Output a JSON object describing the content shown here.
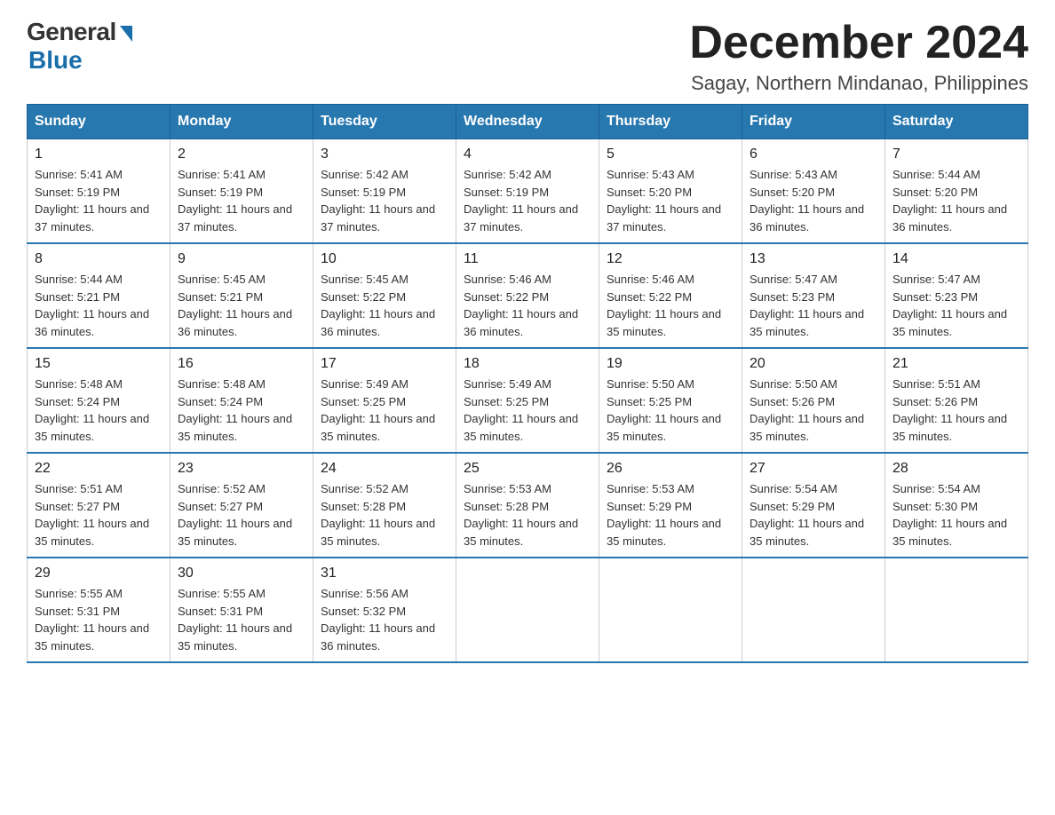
{
  "logo": {
    "general": "General",
    "blue": "Blue"
  },
  "header": {
    "month_year": "December 2024",
    "location": "Sagay, Northern Mindanao, Philippines"
  },
  "weekdays": [
    "Sunday",
    "Monday",
    "Tuesday",
    "Wednesday",
    "Thursday",
    "Friday",
    "Saturday"
  ],
  "weeks": [
    [
      {
        "day": "1",
        "sunrise": "5:41 AM",
        "sunset": "5:19 PM",
        "daylight": "11 hours and 37 minutes."
      },
      {
        "day": "2",
        "sunrise": "5:41 AM",
        "sunset": "5:19 PM",
        "daylight": "11 hours and 37 minutes."
      },
      {
        "day": "3",
        "sunrise": "5:42 AM",
        "sunset": "5:19 PM",
        "daylight": "11 hours and 37 minutes."
      },
      {
        "day": "4",
        "sunrise": "5:42 AM",
        "sunset": "5:19 PM",
        "daylight": "11 hours and 37 minutes."
      },
      {
        "day": "5",
        "sunrise": "5:43 AM",
        "sunset": "5:20 PM",
        "daylight": "11 hours and 37 minutes."
      },
      {
        "day": "6",
        "sunrise": "5:43 AM",
        "sunset": "5:20 PM",
        "daylight": "11 hours and 36 minutes."
      },
      {
        "day": "7",
        "sunrise": "5:44 AM",
        "sunset": "5:20 PM",
        "daylight": "11 hours and 36 minutes."
      }
    ],
    [
      {
        "day": "8",
        "sunrise": "5:44 AM",
        "sunset": "5:21 PM",
        "daylight": "11 hours and 36 minutes."
      },
      {
        "day": "9",
        "sunrise": "5:45 AM",
        "sunset": "5:21 PM",
        "daylight": "11 hours and 36 minutes."
      },
      {
        "day": "10",
        "sunrise": "5:45 AM",
        "sunset": "5:22 PM",
        "daylight": "11 hours and 36 minutes."
      },
      {
        "day": "11",
        "sunrise": "5:46 AM",
        "sunset": "5:22 PM",
        "daylight": "11 hours and 36 minutes."
      },
      {
        "day": "12",
        "sunrise": "5:46 AM",
        "sunset": "5:22 PM",
        "daylight": "11 hours and 35 minutes."
      },
      {
        "day": "13",
        "sunrise": "5:47 AM",
        "sunset": "5:23 PM",
        "daylight": "11 hours and 35 minutes."
      },
      {
        "day": "14",
        "sunrise": "5:47 AM",
        "sunset": "5:23 PM",
        "daylight": "11 hours and 35 minutes."
      }
    ],
    [
      {
        "day": "15",
        "sunrise": "5:48 AM",
        "sunset": "5:24 PM",
        "daylight": "11 hours and 35 minutes."
      },
      {
        "day": "16",
        "sunrise": "5:48 AM",
        "sunset": "5:24 PM",
        "daylight": "11 hours and 35 minutes."
      },
      {
        "day": "17",
        "sunrise": "5:49 AM",
        "sunset": "5:25 PM",
        "daylight": "11 hours and 35 minutes."
      },
      {
        "day": "18",
        "sunrise": "5:49 AM",
        "sunset": "5:25 PM",
        "daylight": "11 hours and 35 minutes."
      },
      {
        "day": "19",
        "sunrise": "5:50 AM",
        "sunset": "5:25 PM",
        "daylight": "11 hours and 35 minutes."
      },
      {
        "day": "20",
        "sunrise": "5:50 AM",
        "sunset": "5:26 PM",
        "daylight": "11 hours and 35 minutes."
      },
      {
        "day": "21",
        "sunrise": "5:51 AM",
        "sunset": "5:26 PM",
        "daylight": "11 hours and 35 minutes."
      }
    ],
    [
      {
        "day": "22",
        "sunrise": "5:51 AM",
        "sunset": "5:27 PM",
        "daylight": "11 hours and 35 minutes."
      },
      {
        "day": "23",
        "sunrise": "5:52 AM",
        "sunset": "5:27 PM",
        "daylight": "11 hours and 35 minutes."
      },
      {
        "day": "24",
        "sunrise": "5:52 AM",
        "sunset": "5:28 PM",
        "daylight": "11 hours and 35 minutes."
      },
      {
        "day": "25",
        "sunrise": "5:53 AM",
        "sunset": "5:28 PM",
        "daylight": "11 hours and 35 minutes."
      },
      {
        "day": "26",
        "sunrise": "5:53 AM",
        "sunset": "5:29 PM",
        "daylight": "11 hours and 35 minutes."
      },
      {
        "day": "27",
        "sunrise": "5:54 AM",
        "sunset": "5:29 PM",
        "daylight": "11 hours and 35 minutes."
      },
      {
        "day": "28",
        "sunrise": "5:54 AM",
        "sunset": "5:30 PM",
        "daylight": "11 hours and 35 minutes."
      }
    ],
    [
      {
        "day": "29",
        "sunrise": "5:55 AM",
        "sunset": "5:31 PM",
        "daylight": "11 hours and 35 minutes."
      },
      {
        "day": "30",
        "sunrise": "5:55 AM",
        "sunset": "5:31 PM",
        "daylight": "11 hours and 35 minutes."
      },
      {
        "day": "31",
        "sunrise": "5:56 AM",
        "sunset": "5:32 PM",
        "daylight": "11 hours and 36 minutes."
      },
      null,
      null,
      null,
      null
    ]
  ],
  "labels": {
    "sunrise": "Sunrise:",
    "sunset": "Sunset:",
    "daylight": "Daylight:"
  }
}
